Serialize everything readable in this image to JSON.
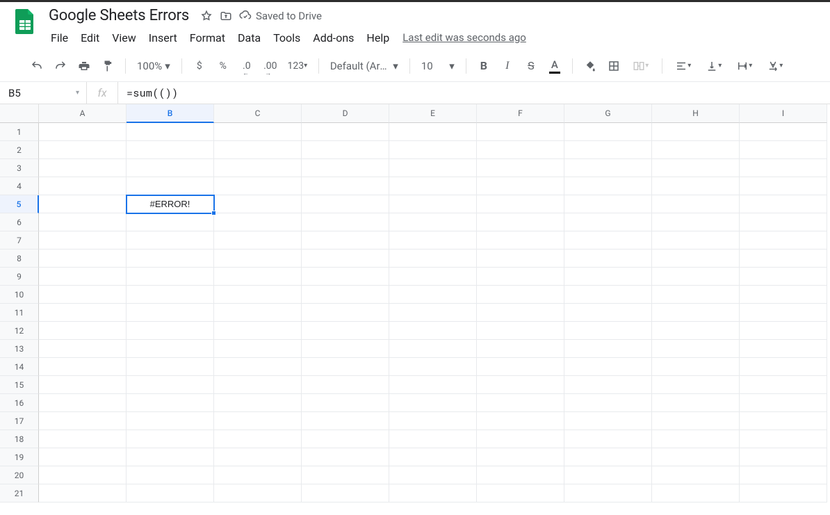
{
  "doc": {
    "title": "Google Sheets Errors",
    "save_state": "Saved to Drive",
    "last_edit": "Last edit was seconds ago"
  },
  "menubar": [
    "File",
    "Edit",
    "View",
    "Insert",
    "Format",
    "Data",
    "Tools",
    "Add-ons",
    "Help"
  ],
  "toolbar": {
    "zoom": "100%",
    "currency": "$",
    "percent": "%",
    "dec_dec": ".0",
    "inc_dec": ".00",
    "num_fmt": "123",
    "font": "Default (Ari...",
    "font_size": "10"
  },
  "namebox": {
    "value": "B5"
  },
  "formula": {
    "value": "=sum(())"
  },
  "columns": [
    "A",
    "B",
    "C",
    "D",
    "E",
    "F",
    "G",
    "H",
    "I"
  ],
  "rows_count": 21,
  "selection": {
    "row": 5,
    "col": "B"
  },
  "cells": {
    "B5": "#ERROR!"
  }
}
